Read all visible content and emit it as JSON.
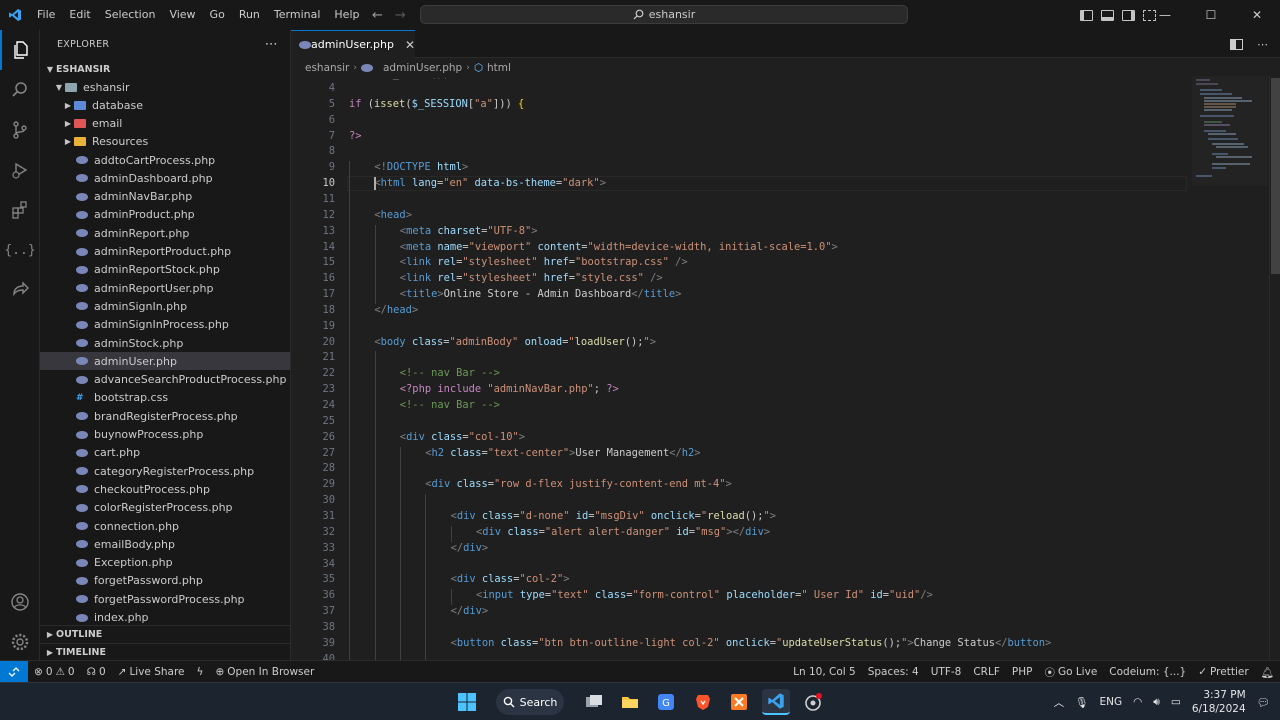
{
  "titlebar": {
    "menu": [
      "File",
      "Edit",
      "Selection",
      "View",
      "Go",
      "Run",
      "Terminal",
      "Help"
    ],
    "search_text": "eshansir"
  },
  "sidebar": {
    "title": "EXPLORER",
    "root": "ESHANSIR",
    "project": "eshansir",
    "folders": [
      "database",
      "email",
      "Resources"
    ],
    "files": [
      "addtoCartProcess.php",
      "adminDashboard.php",
      "adminNavBar.php",
      "adminProduct.php",
      "adminReport.php",
      "adminReportProduct.php",
      "adminReportStock.php",
      "adminReportUser.php",
      "adminSignIn.php",
      "adminSignInProcess.php",
      "adminStock.php",
      "adminUser.php",
      "advanceSearchProductProcess.php",
      "bootstrap.css",
      "brandRegisterProcess.php",
      "buynowProcess.php",
      "cart.php",
      "categoryRegisterProcess.php",
      "checkoutProcess.php",
      "colorRegisterProcess.php",
      "connection.php",
      "emailBody.php",
      "Exception.php",
      "forgetPassword.php",
      "forgetPasswordProcess.php",
      "index.php"
    ],
    "selected": "adminUser.php",
    "outline": "OUTLINE",
    "timeline": "TIMELINE"
  },
  "editor": {
    "tab": "adminUser.php",
    "breadcrumb": [
      "eshansir",
      "adminUser.php",
      "html"
    ],
    "current_line": 10
  },
  "status": {
    "errors": "0",
    "warnings": "0",
    "ports": "0",
    "live_share": "Live Share",
    "open_browser": "Open In Browser",
    "position": "Ln 10, Col 5",
    "spaces": "Spaces: 4",
    "encoding": "UTF-8",
    "eol": "CRLF",
    "language": "PHP",
    "go_live": "Go Live",
    "codeium": "Codeium: {...}",
    "prettier": "Prettier"
  },
  "taskbar": {
    "search": "Search",
    "lang": "ENG",
    "time": "3:37 PM",
    "date": "6/18/2024"
  },
  "colors": {
    "accent": "#0078d4",
    "background": "#1f1f1f",
    "sidebar": "#181818"
  }
}
